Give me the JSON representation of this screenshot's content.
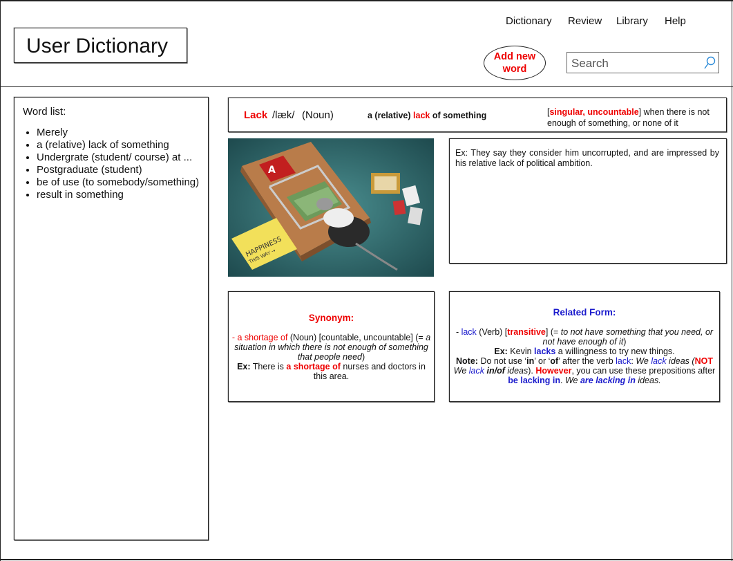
{
  "header": {
    "title": "User Dictionary",
    "nav": [
      "Dictionary",
      "Review",
      "Library",
      "Help"
    ],
    "add_button": "Add new word",
    "search_placeholder": "Search"
  },
  "word_list": {
    "label": "Word list:",
    "items": [
      "Merely",
      "a (relative) lack of something",
      "Undergrate (student/ course) at ...",
      "Postgraduate (student)",
      "be of use (to somebody/something)",
      "result in something"
    ]
  },
  "entry": {
    "word": "Lack",
    "pronunciation": "/læk/",
    "pos": "(Noun)",
    "phrase_pre": "a (relative) ",
    "phrase_word": "lack",
    "phrase_post": " of something",
    "grammar_label": "singular, uncountable",
    "grammar_definition": "when there is not enough of something, or none of it",
    "example": "Ex: They say they consider him uncorrupted, and are impressed by his relative lack of political ambition.",
    "image": {
      "trap_label": "HAPPINESS",
      "note_text": "HAPPINESS THIS WAY"
    }
  },
  "synonym": {
    "title": "Synonym:",
    "term": "- a shortage of",
    "pos": " (Noun) [countable, uncountable] (=",
    "definition": "a situation in which there is not enough of something that people need",
    "ex_label": "Ex:",
    "ex_pre": " There is ",
    "ex_highlight": "a shortage of",
    "ex_post": " nurses and doctors in this area."
  },
  "related": {
    "title": "Related Form:",
    "dash": "- ",
    "verb": "lack",
    "verb_pos": " (Verb) [",
    "verb_gram": "transitive",
    "verb_eq": "] (= ",
    "verb_def": "to not have something that you need, or not have enough of it",
    "ex_label": "Ex:",
    "ex_pre": " Kevin ",
    "ex_word": "lacks",
    "ex_post": " a willingness to try new things.",
    "note_label": "Note:",
    "note_1": " Do not use ‘",
    "note_in": "in",
    "note_2": "’ or ‘",
    "note_of": "of",
    "note_3": "’ after the verb ",
    "note_lack": "lack",
    "note_4": ": ",
    "note_ex1_a": "We ",
    "note_ex1_lack": "lack",
    "note_ex1_b": " ideas (",
    "note_not": "NOT",
    "note_ex2_a": " We ",
    "note_ex2_lack": "lack",
    "note_ex2_inof": " in/of",
    "note_ex2_b": " ideas",
    "note_5": "). ",
    "however": "However",
    "note_6": ", you can use these prepositions after ",
    "be_lacking_in": "be lacking in",
    "note_7": ". ",
    "we": "We ",
    "are_lacking_in": "are lacking in",
    "ideas_end": " ideas."
  }
}
